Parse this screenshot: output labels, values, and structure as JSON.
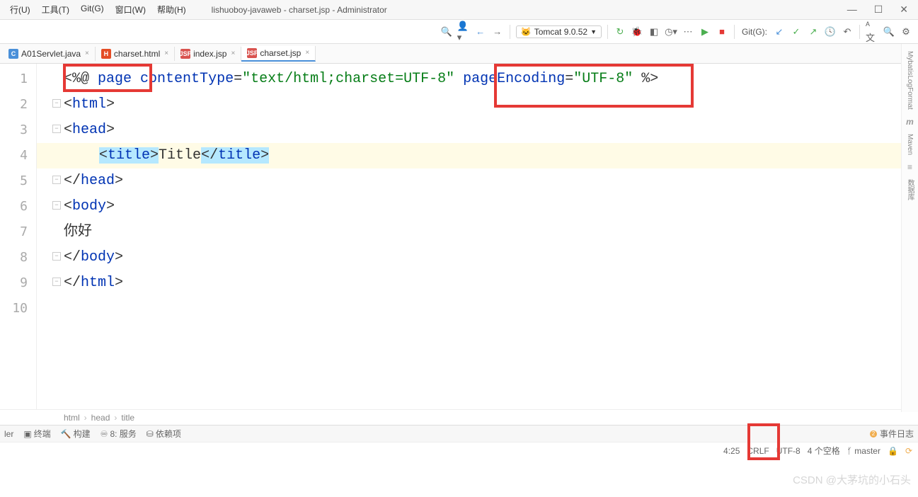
{
  "menu": {
    "items": [
      "行(U)",
      "工具(T)",
      "Git(G)",
      "窗口(W)",
      "帮助(H)"
    ]
  },
  "window": {
    "title": "lishuoboy-javaweb - charset.jsp - Administrator"
  },
  "toolbar": {
    "tomcat_label": "Tomcat 9.0.52",
    "git_label": "Git(G):"
  },
  "tabs": [
    {
      "label": "A01Servlet.java",
      "type": "java"
    },
    {
      "label": "charset.html",
      "type": "html"
    },
    {
      "label": "index.jsp",
      "type": "jsp"
    },
    {
      "label": "charset.jsp",
      "type": "jsp",
      "active": true
    }
  ],
  "code": {
    "lines": [
      "1",
      "2",
      "3",
      "4",
      "5",
      "6",
      "7",
      "8",
      "9",
      "10"
    ],
    "l1_page": "page",
    "l1_ct_attr": "contentType",
    "l1_ct_val": "\"text/html;charset=UTF-8\"",
    "l1_pe_attr": "pageEncoding",
    "l1_pe_val": "\"UTF-8\"",
    "l2_tag": "html",
    "l3_tag": "head",
    "l4_title_open": "title",
    "l4_title_text": "Title",
    "l4_title_close": "title",
    "l5_tag": "head",
    "l6_tag": "body",
    "l7_text": "你好",
    "l8_tag": "body",
    "l9_tag": "html"
  },
  "breadcrumb": [
    "html",
    "head",
    "title"
  ],
  "right_rail": {
    "r1": "MybatisLogFormat",
    "r2": "Maven",
    "r3": "数据库"
  },
  "bottom_tabs": {
    "t1": "ler",
    "t2": "终端",
    "t3": "构建",
    "t4": "8: 服务",
    "t5": "依赖项",
    "events": "事件日志",
    "events_count": "2"
  },
  "status": {
    "pos": "4:25",
    "lineend": "CRLF",
    "encoding": "UTF-8",
    "indent": "4 个空格",
    "branch_label": "master"
  },
  "watermark": "CSDN @大茅坑的小石头"
}
